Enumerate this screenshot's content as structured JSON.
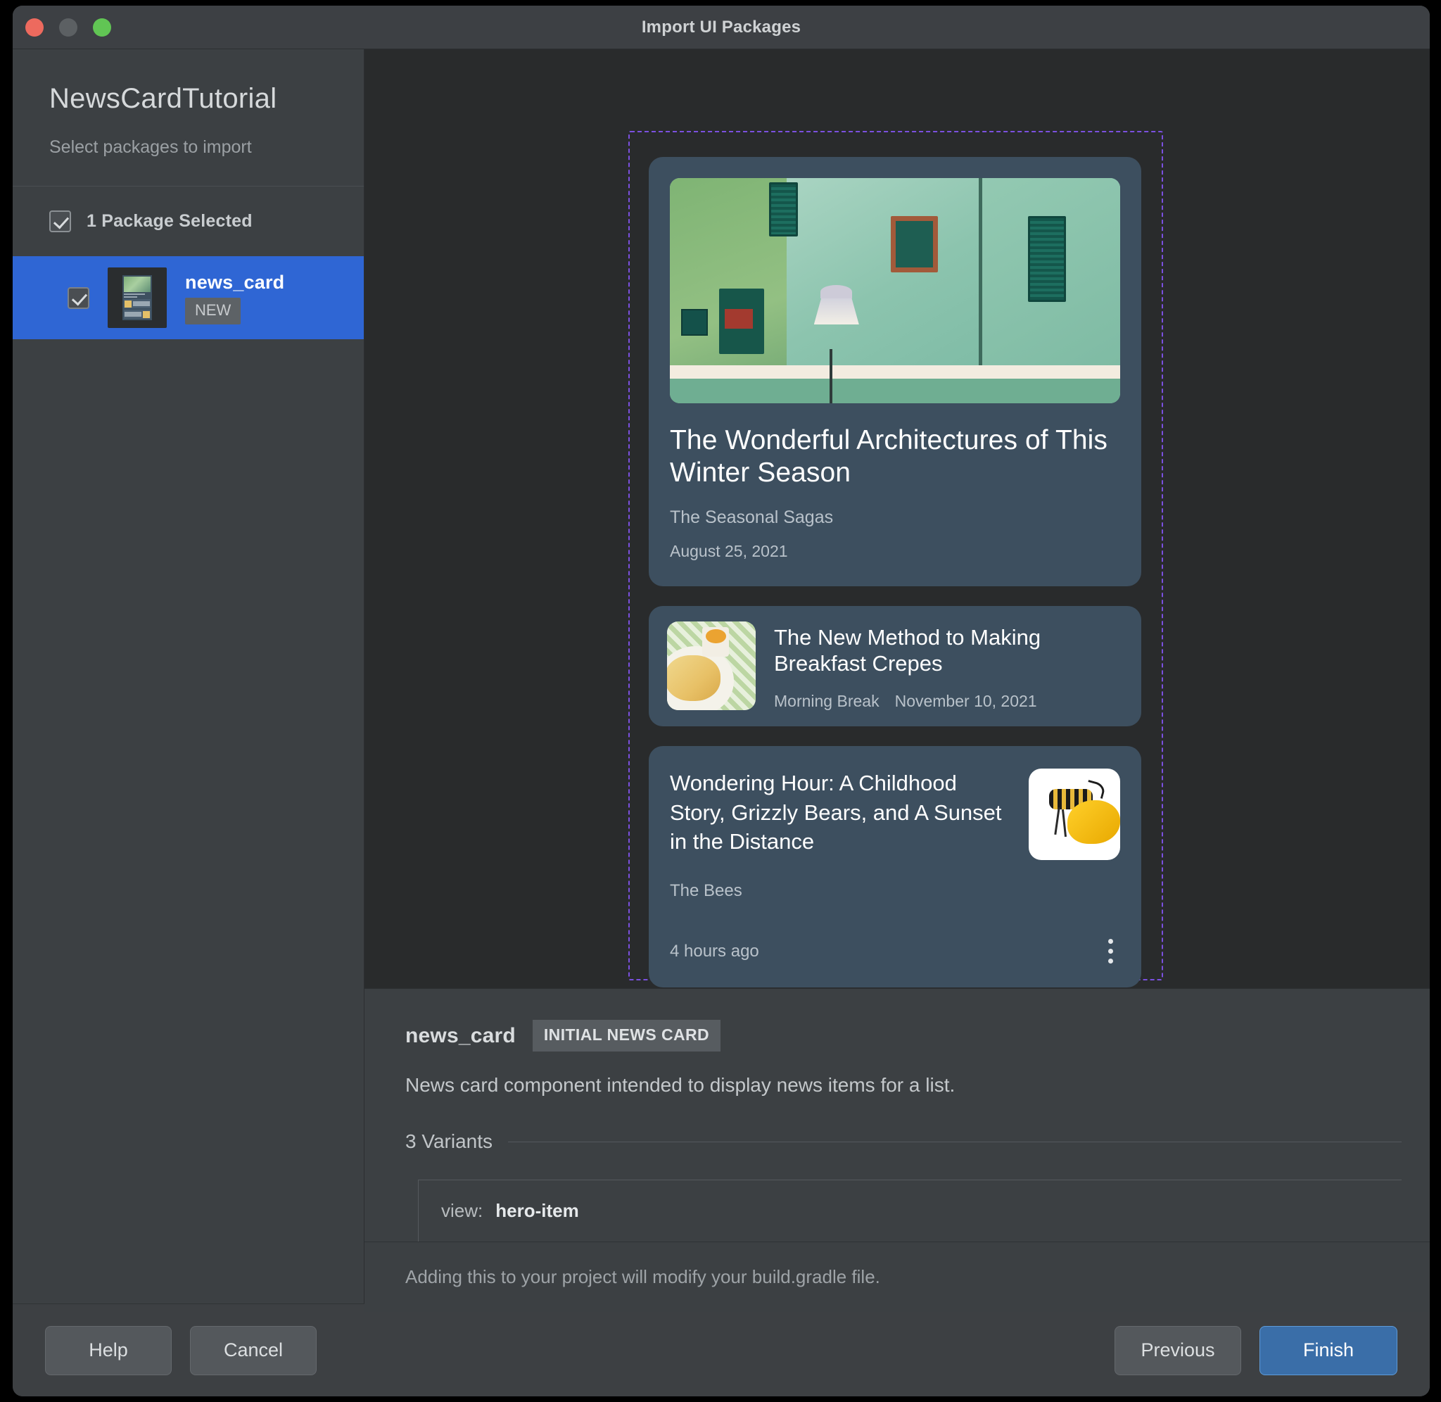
{
  "window": {
    "title": "Import UI Packages",
    "traffic_lights": [
      "close-button",
      "minimize-button",
      "maximize-button"
    ]
  },
  "sidebar": {
    "project_name": "NewsCardTutorial",
    "subtitle": "Select packages to import",
    "selection_summary": "1 Package Selected",
    "packages": [
      {
        "name": "news_card",
        "badge": "NEW",
        "selected": true
      }
    ]
  },
  "preview": {
    "cards": [
      {
        "variant": "hero-item",
        "title": "The Wonderful Architectures of This Winter Season",
        "source": "The Seasonal Sagas",
        "date": "August 25, 2021"
      },
      {
        "variant": "compact-item",
        "title": "The New Method to Making Breakfast Crepes",
        "source": "Morning Break",
        "date": "November 10, 2021"
      },
      {
        "variant": "detail-item",
        "title": "Wondering Hour: A Childhood Story, Grizzly Bears, and A Sunset in the Distance",
        "source": "The Bees",
        "date": "4 hours ago",
        "overflow_icon": "kebab-menu-icon"
      }
    ],
    "selection_outline_color": "#7b50e0"
  },
  "detail": {
    "name": "news_card",
    "tag": "INITIAL NEWS CARD",
    "description": "News card component intended to display news items for a list.",
    "variants_label": "3 Variants",
    "variants": [
      {
        "key": "view:",
        "value": "hero-item"
      }
    ],
    "note": "Adding this to your project will modify your build.gradle file."
  },
  "footer": {
    "help_label": "Help",
    "cancel_label": "Cancel",
    "previous_label": "Previous",
    "finish_label": "Finish",
    "accent_color": "#3a6ea8"
  }
}
